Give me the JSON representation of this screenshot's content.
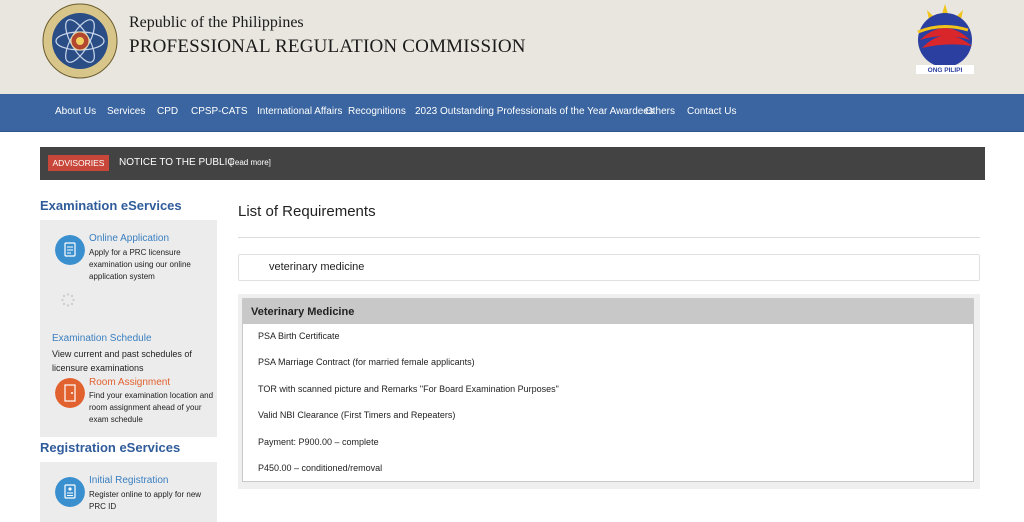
{
  "header": {
    "republic": "Republic of the Philippines",
    "commission": "PROFESSIONAL REGULATION COMMISSION",
    "bp_logo_text": "ONG PILIPI"
  },
  "nav": {
    "items": [
      "About Us",
      "Services",
      "CPD",
      "CPSP-CATS",
      "International Affairs",
      "Recognitions",
      "2023 Outstanding Professionals of the Year Awardees",
      "Others",
      "Contact Us"
    ]
  },
  "advisory": {
    "badge": "ADVISORIES",
    "text": "NOTICE TO THE PUBLIC",
    "more": "[read more]"
  },
  "sidebar": {
    "exam_title": "Examination eServices",
    "online_app": {
      "title": "Online Application",
      "desc": [
        "Apply for a PRC licensure",
        "examination using our online",
        "application system"
      ]
    },
    "exam_sched": {
      "title": "Examination Schedule",
      "desc": [
        "View current and past schedules of",
        "licensure examinations"
      ]
    },
    "room": {
      "title": "Room Assignment",
      "desc": [
        "Find your examination location and",
        "room assignment ahead of your",
        "exam schedule"
      ]
    },
    "reg_title": "Registration eServices",
    "initial_reg": {
      "title": "Initial Registration",
      "desc": [
        "Register online to apply for new",
        "PRC ID"
      ]
    }
  },
  "main": {
    "title": "List of Requirements",
    "search_value": "veterinary medicine",
    "profession": "Veterinary Medicine",
    "requirements": [
      "PSA Birth Certificate",
      "PSA Marriage Contract (for married female applicants)",
      "TOR with scanned picture and Remarks \"For Board Examination Purposes\"",
      "Valid NBI Clearance (First Timers and Repeaters)",
      "Payment: P900.00 – complete",
      "P450.00 – conditioned/removal"
    ]
  },
  "colors": {
    "nav_bg": "#3a65a0",
    "accent_blue": "#2f5c9a",
    "link_blue": "#3a7fc0",
    "room_orange": "#e2622f",
    "badge_red": "#c9473a"
  },
  "icons": [
    "prc-seal-icon",
    "bagong-pilipinas-logo-icon",
    "online-application-icon",
    "loading-spinner-icon",
    "room-assignment-icon",
    "initial-registration-icon"
  ]
}
